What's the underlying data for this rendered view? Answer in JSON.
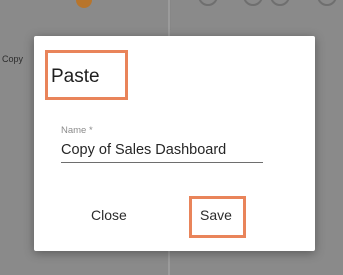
{
  "background": {
    "copy_label": "Copy"
  },
  "dialog": {
    "title": "Paste",
    "name_field": {
      "label": "Name *",
      "value": "Copy of Sales Dashboard"
    },
    "close_label": "Close",
    "save_label": "Save"
  },
  "colors": {
    "highlight": "#e9845a",
    "accent_dot": "#b8752c",
    "overlay": "#8a8a8a"
  }
}
